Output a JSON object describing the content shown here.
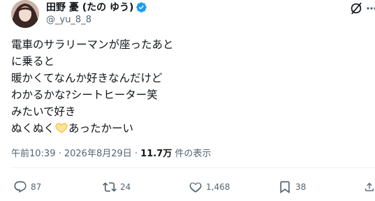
{
  "tweet": {
    "display_name": "田野 憂 (たの ゆう)",
    "handle": "@_yu_8_8",
    "lines": [
      "電車のサラリーマンが座ったあと",
      "に乗ると",
      "暖かくてなんか好きなんだけど",
      "わかるかな?シートヒーター笑",
      "みたいで好き"
    ],
    "last_line_before_emoji": "ぬくぬく",
    "emoji_name": "yellow-heart-hands-emoji",
    "last_line_after_emoji": "あったかーい",
    "timestamp": "午前10:39 · 2026年8月29日 ·",
    "views_count": "11.7万",
    "views_label": "件の表示"
  },
  "actions": {
    "reply_count": "87",
    "repost_count": "24",
    "like_count": "1,468",
    "bookmark_count": "38"
  },
  "icons": {
    "verified": "verified-badge-icon",
    "grok": "grok-icon",
    "more": "more-icon",
    "reply": "reply-icon",
    "repost": "repost-icon",
    "like": "heart-icon",
    "bookmark": "bookmark-icon",
    "share": "share-icon"
  },
  "colors": {
    "verified_blue": "#1d9bf0",
    "secondary_text": "#536471",
    "primary_text": "#0f1419",
    "heart_emoji": "#f5c842"
  }
}
